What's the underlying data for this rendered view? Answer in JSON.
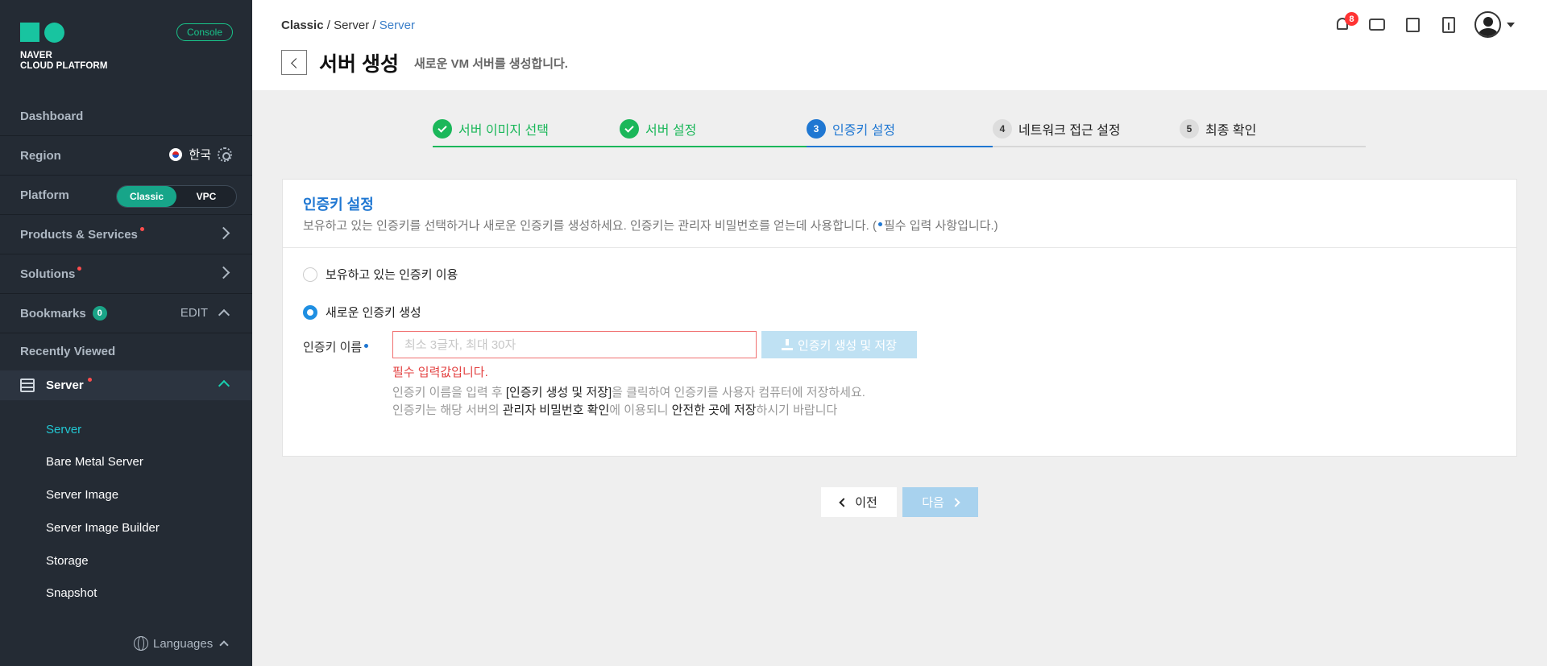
{
  "sidebar": {
    "logo_line1": "NAVER",
    "logo_line2": "CLOUD PLATFORM",
    "console_label": "Console",
    "dashboard": "Dashboard",
    "region_label": "Region",
    "region_value": "한국",
    "platform_label": "Platform",
    "platform_options": [
      "Classic",
      "VPC"
    ],
    "platform_selected": "Classic",
    "products": "Products & Services",
    "solutions": "Solutions",
    "bookmarks": "Bookmarks",
    "bookmarks_count": "0",
    "bookmarks_edit": "EDIT",
    "recently_viewed": "Recently Viewed",
    "server_group": "Server",
    "sub_items": [
      "Server",
      "Bare Metal Server",
      "Server Image",
      "Server Image Builder",
      "Storage",
      "Snapshot"
    ],
    "languages": "Languages"
  },
  "header": {
    "breadcrumb": [
      "Classic",
      "Server",
      "Server"
    ],
    "title": "서버 생성",
    "subtitle": "새로운 VM 서버를 생성합니다.",
    "notification_count": "8"
  },
  "steps": [
    {
      "num": "1",
      "label": "서버 이미지 선택",
      "state": "done"
    },
    {
      "num": "2",
      "label": "서버 설정",
      "state": "done"
    },
    {
      "num": "3",
      "label": "인증키 설정",
      "state": "current"
    },
    {
      "num": "4",
      "label": "네트워크 접근 설정",
      "state": "todo"
    },
    {
      "num": "5",
      "label": "최종 확인",
      "state": "todo"
    }
  ],
  "card": {
    "title": "인증키 설정",
    "desc_main": "보유하고 있는 인증키를 선택하거나 새로운 인증키를 생성하세요. 인증키는 관리자 비밀번호를 얻는데 사용합니다. (",
    "desc_required": "필수 입력 사항입니다.)",
    "option_existing": "보유하고 있는 인증키 이용",
    "option_new": "새로운 인증키 생성",
    "selected_option": "새로운 인증키 생성",
    "field_label": "인증키 이름",
    "input_placeholder": "최소 3글자, 최대 30자",
    "input_value": "",
    "generate_button": "인증키 생성 및 저장",
    "error": "필수 입력값입니다.",
    "help1_a": "인증키 이름을 입력 후 ",
    "help1_b": "[인증키 생성 및 저장]",
    "help1_c": "을 클릭하여 인증키를 사용자 컴퓨터에 저장하세요.",
    "help2_a": "인증키는 해당 서버의 ",
    "help2_b": "관리자 비밀번호 확인",
    "help2_c": "에 이용되니 ",
    "help2_d": "안전한 곳에 저장",
    "help2_e": "하시기 바랍니다"
  },
  "footer": {
    "prev": "이전",
    "next": "다음"
  },
  "colors": {
    "sidebar_bg": "#242b34",
    "accent_green": "#1bb75a",
    "accent_blue": "#1f77d2",
    "error_red": "#e34141"
  }
}
